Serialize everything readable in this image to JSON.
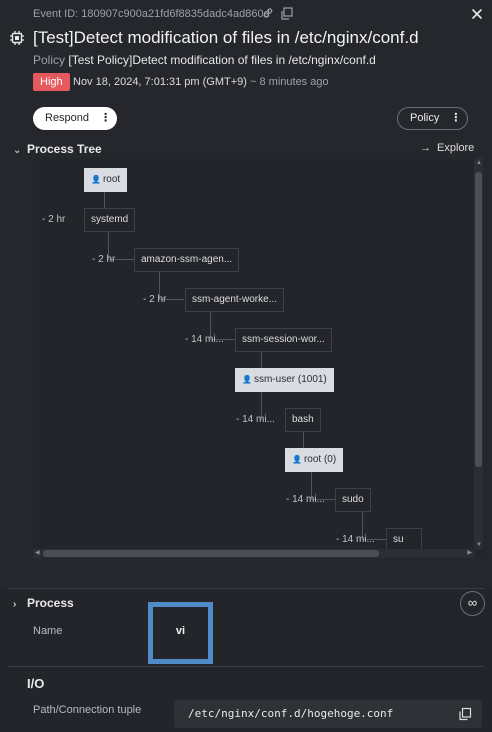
{
  "header": {
    "event_id": "Event ID: 180907c900a21fd6f8835dadc4ad860d",
    "title": "[Test]Detect modification of files in /etc/nginx/conf.d",
    "policy_label": "Policy",
    "policy_value": "[Test Policy]Detect modification of files in /etc/nginx/conf.d",
    "severity": "High",
    "timestamp": "Nov 18, 2024, 7:01:31 pm (GMT+9)",
    "relative_time": "~ 8 minutes ago",
    "respond_label": "Respond",
    "policy_button_label": "Policy",
    "kebab": "⋮",
    "severity_color": "#e45a5f"
  },
  "process_tree": {
    "section_label": "Process Tree",
    "explore_label": "Explore",
    "nodes": [
      {
        "label": "root",
        "user": true
      },
      {
        "label": "systemd",
        "user": false,
        "elapsed": "- 2 hr"
      },
      {
        "label": "amazon-ssm-agen...",
        "user": false,
        "elapsed": "- 2 hr"
      },
      {
        "label": "ssm-agent-worke...",
        "user": false,
        "elapsed": "- 2 hr"
      },
      {
        "label": "ssm-session-wor...",
        "user": false,
        "elapsed": "- 14 mi..."
      },
      {
        "label": "ssm-user (1001)",
        "user": true
      },
      {
        "label": "bash",
        "user": false,
        "elapsed": "- 14 mi..."
      },
      {
        "label": "root (0)",
        "user": true
      },
      {
        "label": "sudo",
        "user": false,
        "elapsed": "- 14 mi..."
      },
      {
        "label": "su",
        "user": false,
        "elapsed": "- 14 mi..."
      }
    ]
  },
  "process": {
    "section_label": "Process",
    "name_label": "Name",
    "name_value": "vi"
  },
  "io": {
    "section_label": "I/O",
    "path_label": "Path/Connection tuple",
    "path_value": "/etc/nginx/conf.d/hogehoge.conf"
  }
}
